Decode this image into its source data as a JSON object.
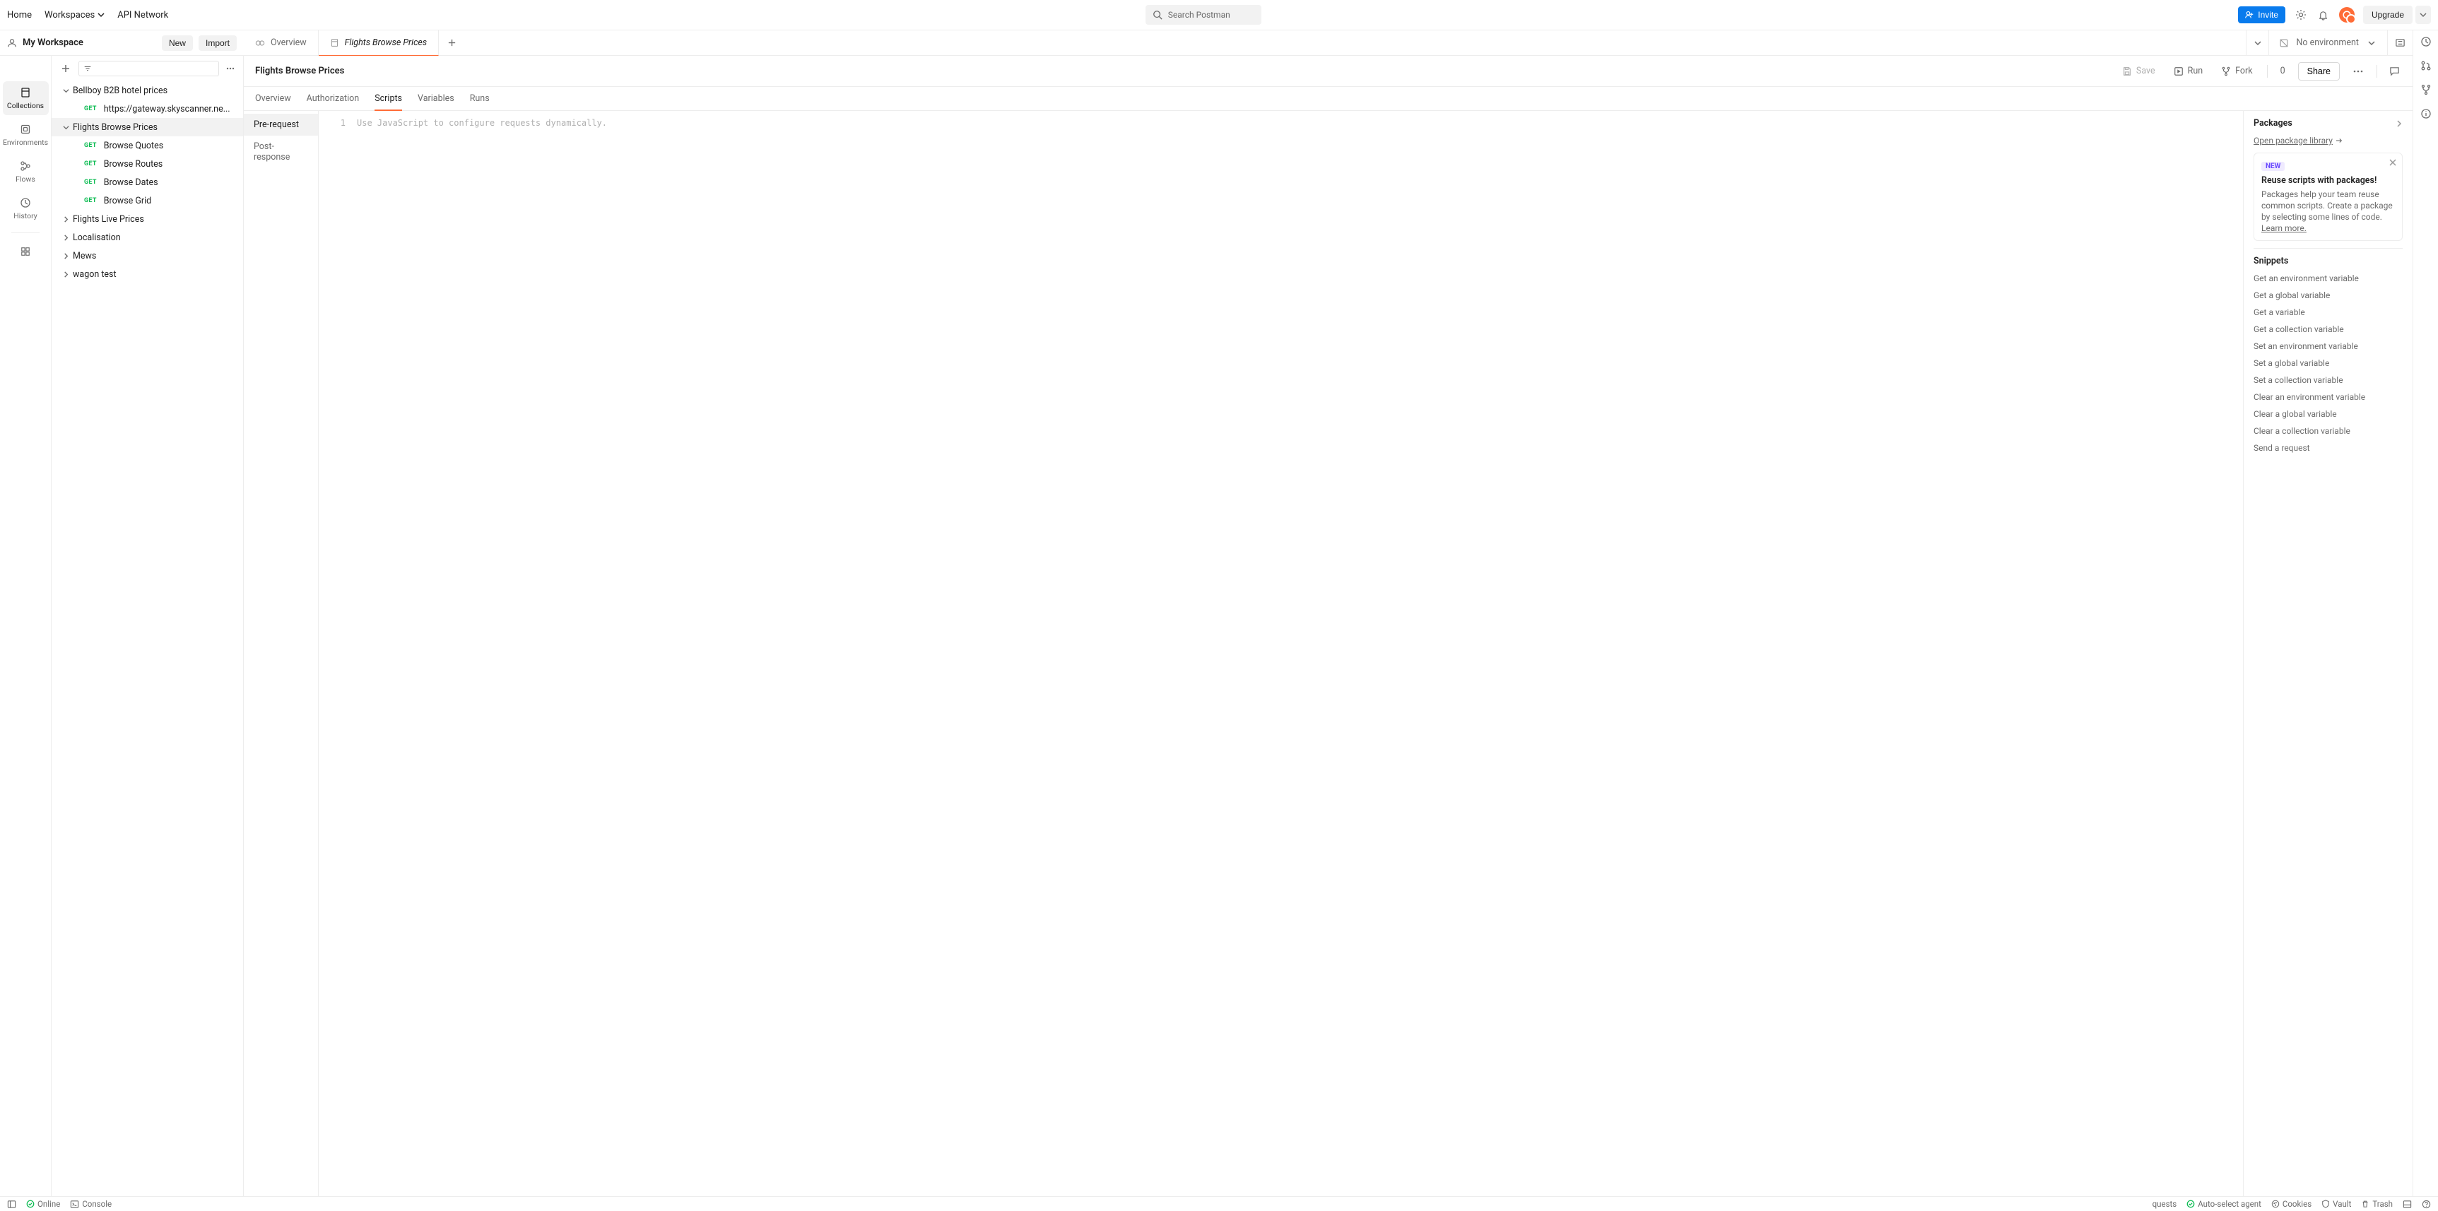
{
  "topbar": {
    "home": "Home",
    "workspaces": "Workspaces",
    "api_network": "API Network",
    "search_placeholder": "Search Postman",
    "invite": "Invite",
    "upgrade": "Upgrade"
  },
  "workspace": {
    "title": "My Workspace",
    "new": "New",
    "import": "Import"
  },
  "rail": {
    "collections": "Collections",
    "environments": "Environments",
    "flows": "Flows",
    "history": "History"
  },
  "tree": {
    "bellboy": "Bellboy B2B hotel prices",
    "bellboy_req": "https://gateway.skyscanner.ne...",
    "flights_browse": "Flights Browse Prices",
    "browse_quotes": "Browse Quotes",
    "browse_routes": "Browse Routes",
    "browse_dates": "Browse Dates",
    "browse_grid": "Browse Grid",
    "flights_live": "Flights Live Prices",
    "localisation": "Localisation",
    "mews": "Mews",
    "wagon": "wagon test"
  },
  "tabs": {
    "overview": "Overview",
    "flights": "Flights Browse Prices"
  },
  "env": {
    "label": "No environment"
  },
  "item": {
    "title": "Flights Browse Prices",
    "save": "Save",
    "run": "Run",
    "fork": "Fork",
    "fork_count": "0",
    "share": "Share"
  },
  "subtabs": {
    "overview": "Overview",
    "authorization": "Authorization",
    "scripts": "Scripts",
    "variables": "Variables",
    "runs": "Runs"
  },
  "scriptnav": {
    "pre": "Pre-request",
    "post": "Post-response"
  },
  "editor": {
    "line1": "1",
    "placeholder": "Use JavaScript to configure requests dynamically."
  },
  "packages": {
    "title": "Packages",
    "open_link": "Open package library",
    "badge": "NEW",
    "card_title": "Reuse scripts with packages!",
    "card_body": "Packages help your team reuse common scripts. Create a package by selecting some lines of code.",
    "learn_more": "Learn more."
  },
  "snippets": {
    "title": "Snippets",
    "items": [
      "Get an environment variable",
      "Get a global variable",
      "Get a variable",
      "Get a collection variable",
      "Set an environment variable",
      "Set a global variable",
      "Set a collection variable",
      "Clear an environment variable",
      "Clear a global variable",
      "Clear a collection variable",
      "Send a request"
    ]
  },
  "status": {
    "online": "Online",
    "console": "Console",
    "requests": "quests",
    "auto_agent": "Auto-select agent",
    "cookies": "Cookies",
    "vault": "Vault",
    "trash": "Trash"
  }
}
